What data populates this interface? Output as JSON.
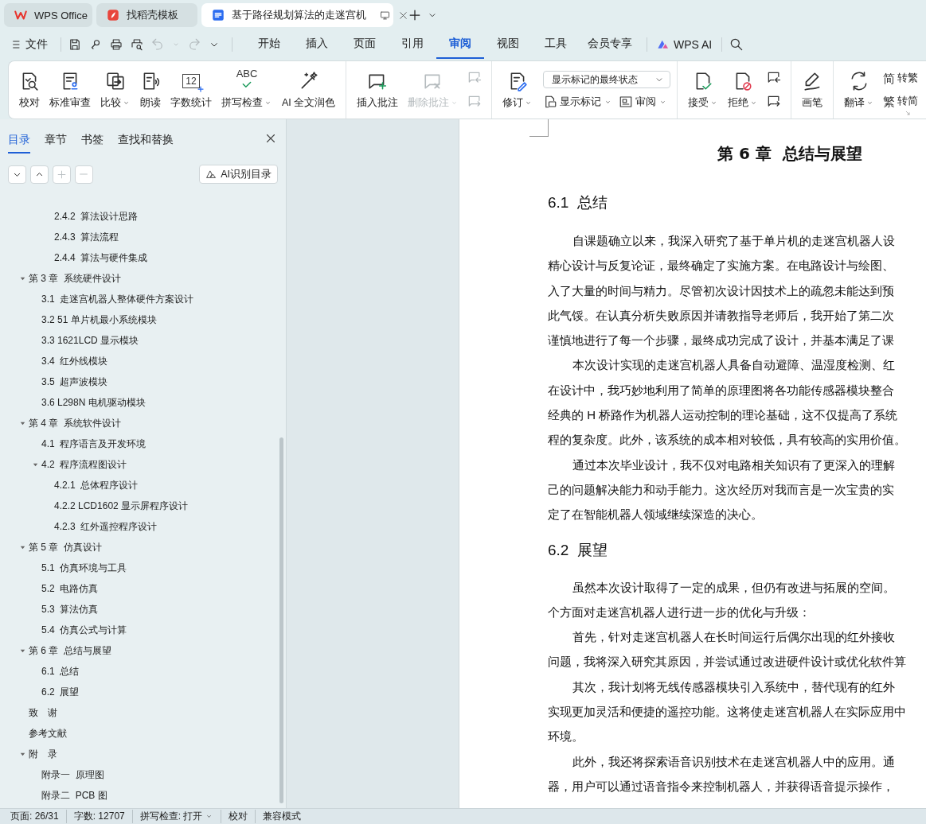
{
  "tabs": [
    {
      "kind": "home",
      "title": "WPS Office",
      "selected": false
    },
    {
      "kind": "template",
      "title": "找稻壳模板",
      "selected": false
    },
    {
      "kind": "document",
      "title": "基于路径规划算法的走迷宫机",
      "selected": true
    }
  ],
  "menu": {
    "file_label": "文件",
    "quick_access": [
      {
        "kind": "save",
        "disabled": false
      },
      {
        "kind": "share",
        "disabled": false
      },
      {
        "kind": "print",
        "disabled": false
      },
      {
        "kind": "print-preview",
        "disabled": false
      },
      {
        "kind": "undo",
        "disabled": true
      },
      {
        "kind": "redo",
        "disabled": true
      }
    ],
    "tabs": [
      {
        "label": "开始",
        "selected": false
      },
      {
        "label": "插入",
        "selected": false
      },
      {
        "label": "页面",
        "selected": false
      },
      {
        "label": "引用",
        "selected": false
      },
      {
        "label": "审阅",
        "selected": true
      },
      {
        "label": "视图",
        "selected": false
      },
      {
        "label": "工具",
        "selected": false
      },
      {
        "label": "会员专享",
        "selected": false
      }
    ],
    "ai_label": "WPS AI"
  },
  "ribbon": {
    "groups": [
      {
        "items": [
          {
            "kind": "large",
            "label": "校对",
            "has_menu": false,
            "disabled": false
          },
          {
            "kind": "large",
            "label": "标准审查",
            "has_menu": false,
            "disabled": false
          },
          {
            "kind": "large",
            "label": "比较",
            "has_menu": true,
            "disabled": false
          },
          {
            "kind": "large",
            "label": "朗读",
            "has_menu": false,
            "disabled": false
          },
          {
            "kind": "large",
            "icon_text": "12",
            "label": "字数统计",
            "has_menu": false,
            "disabled": false
          },
          {
            "kind": "large",
            "icon_text": "ABC",
            "label": "拼写检查",
            "has_menu": true,
            "disabled": false
          },
          {
            "kind": "large",
            "label": "AI 全文润色",
            "has_menu": false,
            "disabled": false
          }
        ]
      },
      {
        "items": [
          {
            "kind": "large",
            "label": "插入批注",
            "has_menu": false,
            "disabled": false
          },
          {
            "kind": "large",
            "label": "删除批注",
            "has_menu": true,
            "disabled": true
          },
          {
            "kind": "stack",
            "buttons": [
              {
                "disabled": true
              },
              {
                "disabled": true
              }
            ]
          }
        ]
      },
      {
        "items": [
          {
            "kind": "large",
            "label": "修订",
            "has_menu": true,
            "disabled": false
          },
          {
            "kind": "panel",
            "dropdown": "显示标记的最终状态",
            "buttons": [
              {
                "label": "显示标记",
                "has_menu": true
              },
              {
                "label": "审阅",
                "has_menu": true
              }
            ]
          }
        ]
      },
      {
        "items": [
          {
            "kind": "large",
            "label": "接受",
            "has_menu": true,
            "disabled": false
          },
          {
            "kind": "large",
            "label": "拒绝",
            "has_menu": true,
            "disabled": false
          },
          {
            "kind": "stack",
            "buttons": [
              {
                "disabled": false
              },
              {
                "disabled": false
              }
            ]
          }
        ]
      },
      {
        "items": [
          {
            "kind": "large",
            "label": "画笔",
            "has_menu": false,
            "disabled": false
          }
        ]
      },
      {
        "items": [
          {
            "kind": "large",
            "label": "翻译",
            "has_menu": true,
            "disabled": false
          },
          {
            "kind": "text-list",
            "buttons": [
              {
                "icon_text": "简",
                "label": "转繁"
              },
              {
                "icon_text": "繁",
                "label": "转简"
              }
            ]
          }
        ]
      }
    ]
  },
  "sidebar": {
    "tabs": [
      {
        "label": "目录",
        "selected": true
      },
      {
        "label": "章节",
        "selected": false
      },
      {
        "label": "书签",
        "selected": false
      },
      {
        "label": "查找和替换",
        "selected": false
      }
    ],
    "tool_buttons": [
      {
        "kind": "collapse",
        "disabled": false
      },
      {
        "kind": "expand",
        "disabled": false
      },
      {
        "kind": "add",
        "disabled": true
      },
      {
        "kind": "remove",
        "disabled": true
      }
    ],
    "ai_button": "AI识别目录",
    "toc": {
      "continued": [
        {
          "label": "2.4.2  算法设计思路"
        },
        {
          "label": "2.4.3  算法流程"
        },
        {
          "label": "2.4.4  算法与硬件集成"
        }
      ],
      "items": [
        {
          "label": "第 3 章  系统硬件设计",
          "expanded": true,
          "children": [
            {
              "label": "3.1  走迷宫机器人整体硬件方案设计"
            },
            {
              "label": "3.2 51 单片机最小系统模块"
            },
            {
              "label": "3.3 1621LCD 显示模块"
            },
            {
              "label": "3.4  红外线模块"
            },
            {
              "label": "3.5  超声波模块"
            },
            {
              "label": "3.6 L298N 电机驱动模块"
            }
          ]
        },
        {
          "label": "第 4 章  系统软件设计",
          "expanded": true,
          "children": [
            {
              "label": "4.1  程序语言及开发环境"
            },
            {
              "label": "4.2  程序流程图设计",
              "expanded": true,
              "children": [
                {
                  "label": "4.2.1  总体程序设计"
                },
                {
                  "label": "4.2.2 LCD1602 显示屏程序设计"
                },
                {
                  "label": "4.2.3  红外遥控程序设计"
                }
              ]
            }
          ]
        },
        {
          "label": "第 5 章  仿真设计",
          "expanded": true,
          "children": [
            {
              "label": "5.1  仿真环境与工具"
            },
            {
              "label": "5.2  电路仿真"
            },
            {
              "label": "5.3  算法仿真"
            },
            {
              "label": "5.4  仿真公式与计算"
            }
          ]
        },
        {
          "label": "第 6 章  总结与展望",
          "expanded": true,
          "children": [
            {
              "label": "6.1  总结"
            },
            {
              "label": "6.2  展望"
            }
          ]
        },
        {
          "label": "致　谢"
        },
        {
          "label": "参考文献"
        },
        {
          "label": "附　录",
          "expanded": true,
          "children": [
            {
              "label": "附录一  原理图"
            },
            {
              "label": "附录二  PCB 图"
            }
          ]
        }
      ]
    }
  },
  "document": {
    "chapter_title": "第 6 章  总结与展望",
    "sections": [
      {
        "heading": "6.1  总结",
        "paragraphs": [
          {
            "lines": [
              "自课题确立以来，我深入研究了基于单片机的走迷宫机器人设",
              "精心设计与反复论证，最终确定了实施方案。在电路设计与绘图、",
              "入了大量的时间与精力。尽管初次设计因技术上的疏忽未能达到预",
              "此气馁。在认真分析失败原因并请教指导老师后，我开始了第二次",
              "谨慎地进行了每一个步骤，最终成功完成了设计，并基本满足了课"
            ]
          },
          {
            "lines": [
              "本次设计实现的走迷宫机器人具备自动避障、温湿度检测、红",
              "在设计中，我巧妙地利用了简单的原理图将各功能传感器模块整合",
              "经典的 H 桥路作为机器人运动控制的理论基础，这不仅提高了系统",
              "程的复杂度。此外，该系统的成本相对较低，具有较高的实用价值。"
            ]
          },
          {
            "lines": [
              "通过本次毕业设计，我不仅对电路相关知识有了更深入的理解",
              "己的问题解决能力和动手能力。这次经历对我而言是一次宝贵的实",
              "定了在智能机器人领域继续深造的决心。"
            ]
          }
        ]
      },
      {
        "heading": "6.2  展望",
        "paragraphs": [
          {
            "lines": [
              "虽然本次设计取得了一定的成果，但仍有改进与拓展的空间。",
              "个方面对走迷宫机器人进行进一步的优化与升级："
            ]
          },
          {
            "lines": [
              "首先，针对走迷宫机器人在长时间运行后偶尔出现的红外接收",
              "问题，我将深入研究其原因，并尝试通过改进硬件设计或优化软件算"
            ]
          },
          {
            "lines": [
              "其次，我计划将无线传感器模块引入系统中，替代现有的红外",
              "实现更加灵活和便捷的遥控功能。这将使走迷宫机器人在实际应用中",
              "环境。"
            ]
          },
          {
            "lines": [
              "此外，我还将探索语音识别技术在走迷宫机器人中的应用。通",
              "器，用户可以通过语音指令来控制机器人，并获得语音提示操作，"
            ]
          }
        ]
      }
    ]
  },
  "status_bar": {
    "items": [
      {
        "kind": "text",
        "label": "页面: 26/31"
      },
      {
        "kind": "text",
        "label": "字数: 12707"
      },
      {
        "kind": "menu",
        "label": "拼写检查: 打开"
      },
      {
        "kind": "text",
        "label": "校对"
      },
      {
        "kind": "text",
        "label": "兼容模式"
      }
    ]
  }
}
